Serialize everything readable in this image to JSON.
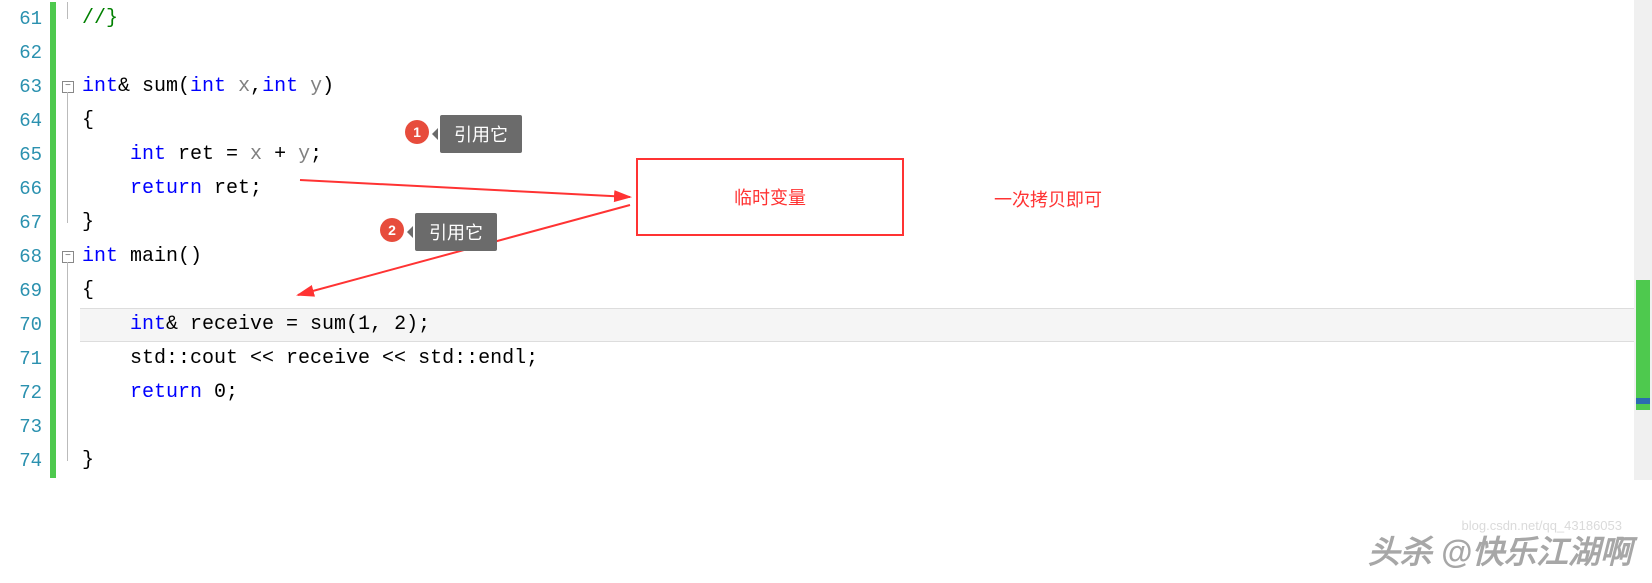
{
  "lines": {
    "start": 61,
    "end": 74
  },
  "code": {
    "l61": "//}",
    "l62": "",
    "l63_int": "int",
    "l63_amp": "& sum(",
    "l63_int2": "int",
    "l63_sp": " ",
    "l63_x": "x",
    "l63_comma": ",",
    "l63_int3": "int",
    "l63_y": "y",
    "l63_close": ")",
    "l64": "{",
    "l65_int": "int",
    "l65_ret": " ret = ",
    "l65_x": "x",
    "l65_plus": " + ",
    "l65_y": "y",
    "l65_semi": ";",
    "l66_return": "return",
    "l66_ret": " ret;",
    "l67": "}",
    "l68_int": "int",
    "l68_main": " main()",
    "l69": "{",
    "l70_int": "int",
    "l70_rest": "& receive = sum(1, 2);",
    "l71": "std::cout << receive << std::endl;",
    "l72_return": "return",
    "l72_zero": " 0;",
    "l73": "",
    "l74": "}"
  },
  "annotations": {
    "badge1": "1",
    "badge2": "2",
    "tooltip1": "引用它",
    "tooltip2": "引用它",
    "tempvar_box": "临时变量",
    "copy_text": "一次拷贝即可"
  },
  "watermark": {
    "main": "头杀 @快乐江湖啊",
    "sub": "blog.csdn.net/qq_43186053"
  }
}
